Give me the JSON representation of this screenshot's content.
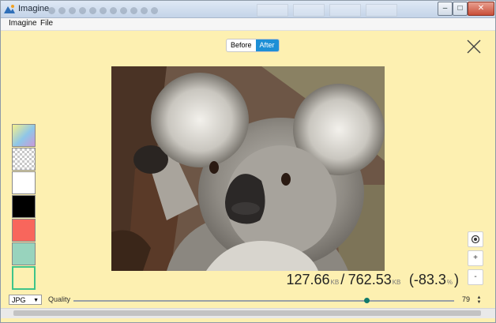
{
  "window": {
    "title": "Imagine",
    "controls": {
      "minimize": "–",
      "maximize": "□",
      "close": "✕"
    }
  },
  "menu": {
    "items": [
      "Imagine",
      "File"
    ]
  },
  "view_toggle": {
    "before_label": "Before",
    "after_label": "After",
    "active": "After"
  },
  "swatches": {
    "items": [
      {
        "name": "gradient",
        "color": "#8ec6e8"
      },
      {
        "name": "checkerboard",
        "color": "#d8d8d8"
      },
      {
        "name": "white",
        "color": "#ffffff"
      },
      {
        "name": "black",
        "color": "#000000"
      },
      {
        "name": "red",
        "color": "#f8665c"
      },
      {
        "name": "mint",
        "color": "#98d3bd"
      },
      {
        "name": "theme",
        "color": "#fdf0b1"
      }
    ],
    "selected": "theme"
  },
  "image": {
    "subject": "koala"
  },
  "sizes": {
    "compressed": "127.66",
    "compressed_unit": "KB",
    "separator": "/",
    "original": "762.53",
    "original_unit": "KB",
    "reduction": "(-83.3",
    "reduction_unit": "%",
    "reduction_close": ")"
  },
  "zoom_controls": {
    "fit_icon": "target-icon",
    "zoom_in": "+",
    "zoom_out": "-"
  },
  "bottom_bar": {
    "format": {
      "selected": "JPG",
      "arrow": "▼"
    },
    "quality_label": "Quality",
    "quality_value": "79",
    "quality_fraction": 0.77,
    "spinner_up": "▲",
    "spinner_down": "▼"
  },
  "colors": {
    "background": "#fdf0b1",
    "accent": "#1e8fd6",
    "slider_thumb": "#117a6b",
    "selection": "#3ec48a"
  }
}
